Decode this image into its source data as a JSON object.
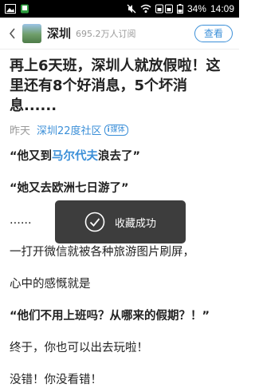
{
  "status_bar": {
    "battery_percent": "34%",
    "time": "14:09",
    "icons": [
      "gallery-icon",
      "phone-icon",
      "mute-icon",
      "wifi-icon",
      "signal-icon",
      "battery-icon"
    ]
  },
  "header": {
    "channel_name": "深圳",
    "subscribers": "695.2万人订阅",
    "view_button": "查看"
  },
  "article": {
    "title": "再上6天班，深圳人就放假啦！这里还有8个好消息，5个坏消息......",
    "date": "昨天",
    "source": "深圳22度社区",
    "badge": "媒体",
    "paragraphs": {
      "p1_pre": "“他又到",
      "p1_link": "马尔代夫",
      "p1_post": "浪去了”",
      "p2": "“她又去欧洲七日游了”",
      "p3": "......",
      "p4": "一打开微信就被各种旅游图片刷屏，",
      "p5": "心中的感慨就是",
      "p6": "“他们不用上班吗？从哪来的假期？！”",
      "p7": "终于，你也可以出去玩啦！",
      "p8": "没错！你没看错！"
    }
  },
  "toast": {
    "message": "收藏成功"
  },
  "colors": {
    "accent": "#3b8fd8",
    "status_bar_bg": "#000000",
    "toast_bg": "#2d2d2d"
  }
}
